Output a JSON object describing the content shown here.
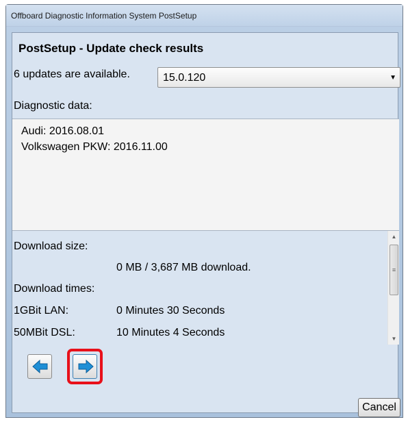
{
  "window": {
    "title": "Offboard Diagnostic Information System PostSetup"
  },
  "heading": "PostSetup - Update check results",
  "updates": {
    "available_label": "6 updates are available.",
    "selected_version": "15.0.120"
  },
  "diagnostic": {
    "label": "Diagnostic data:",
    "entries": [
      "Audi: 2016.08.01",
      "Volkswagen PKW: 2016.11.00"
    ]
  },
  "download": {
    "size_label": "Download size:",
    "size_value": "0 MB / 3,687 MB download.",
    "times_label": "Download times:",
    "rows": [
      {
        "connection": "1GBit LAN:",
        "time": "0 Minutes 30 Seconds"
      },
      {
        "connection": "50MBit DSL:",
        "time": "10 Minutes 4 Seconds"
      }
    ]
  },
  "buttons": {
    "back_icon": "arrow-left-icon",
    "next_icon": "arrow-right-icon",
    "cancel_label": "Cancel"
  },
  "colors": {
    "highlight": "#e8101a",
    "arrow": "#1f8fd6",
    "panel_bg": "#d9e4f1"
  }
}
